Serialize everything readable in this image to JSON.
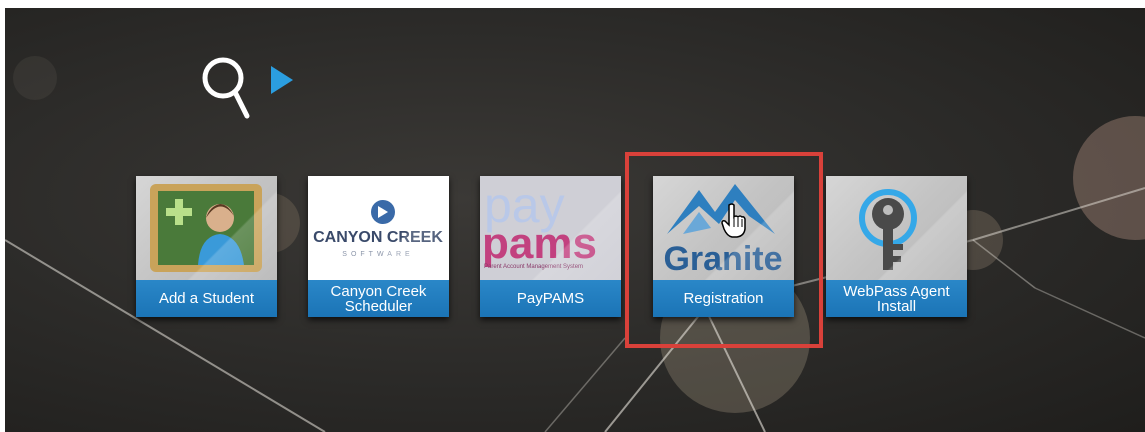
{
  "toolbar": {
    "search_icon": "search-icon",
    "expand_icon": "play-arrow-icon"
  },
  "tiles": [
    {
      "label": "Add a Student",
      "icon": "student-chalkboard-icon"
    },
    {
      "label": "Canyon Creek\nScheduler",
      "icon": "canyon-creek-logo",
      "logo_text": "CANYON CREEK",
      "logo_subtext": "SOFTWARE"
    },
    {
      "label": "PayPAMS",
      "icon": "paypams-logo",
      "logo_text_top": "pay",
      "logo_text_main": "pams",
      "logo_subtext": "Parent Account Management System"
    },
    {
      "label": "Registration",
      "icon": "granite-logo",
      "logo_text": "Granite"
    },
    {
      "label": "WebPass Agent\nInstall",
      "icon": "key-icon"
    }
  ],
  "colors": {
    "background": "#2b2a28",
    "tile_label_bg": "#1b74b6",
    "highlight_border": "#d9413a",
    "accent": "#2b8fd6"
  }
}
